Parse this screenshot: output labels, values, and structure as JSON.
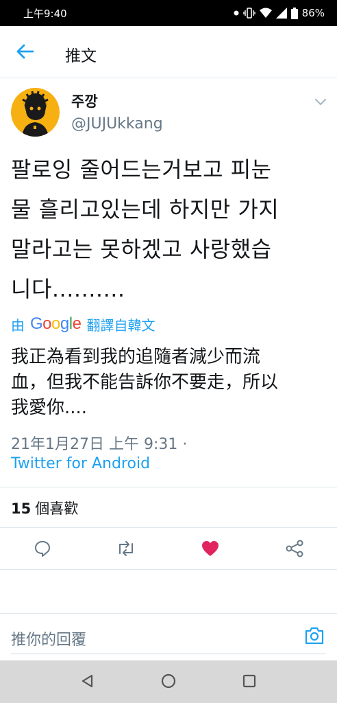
{
  "status_bar": {
    "time": "上午9:40",
    "battery": "86%"
  },
  "header": {
    "title": "推文",
    "back_icon": "arrow-left-icon"
  },
  "tweet": {
    "author_name": "주깡",
    "author_handle": "@JUJUkkang",
    "text_lines": [
      "팔로잉 줄어드는거보고 피눈",
      "물 흘리고있는데 하지만 가지",
      "말라고는 못하겠고 사랑했습",
      "니다.........."
    ],
    "translate_prefix": "由",
    "translate_brand": "Google",
    "translate_suffix": "翻譯自韓文",
    "translation_lines": [
      "我正為看到我的追隨者減少而流",
      "血，但我不能告訴你不要走，所以",
      "我愛你...."
    ],
    "timestamp": "21年1月27日 上午 9:31 ·",
    "source": "Twitter for Android",
    "like_count": "15",
    "like_label": "個喜歡"
  },
  "reply": {
    "placeholder": "推你的回覆"
  },
  "colors": {
    "accent": "#1da1f2",
    "like": "#e0245e",
    "secondary_text": "#657786",
    "avatar_bg": "#f6b012"
  }
}
